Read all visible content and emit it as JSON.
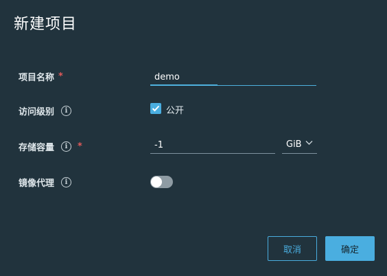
{
  "dialog": {
    "title": "新建项目"
  },
  "fields": {
    "project_name": {
      "label": "项目名称",
      "required_mark": "*",
      "value": "demo"
    },
    "access_level": {
      "label": "访问级别",
      "info_icon": "info-icon",
      "checkbox_label": "公开",
      "checked": true
    },
    "storage_quota": {
      "label": "存储容量",
      "info_icon": "info-icon",
      "required_mark": "*",
      "value": "-1",
      "unit": "GiB"
    },
    "proxy_cache": {
      "label": "镜像代理",
      "info_icon": "info-icon",
      "enabled": false
    }
  },
  "buttons": {
    "cancel": "取消",
    "confirm": "确定"
  },
  "colors": {
    "background": "#21333d",
    "accent": "#4aaee0",
    "required": "#e15a5a"
  }
}
